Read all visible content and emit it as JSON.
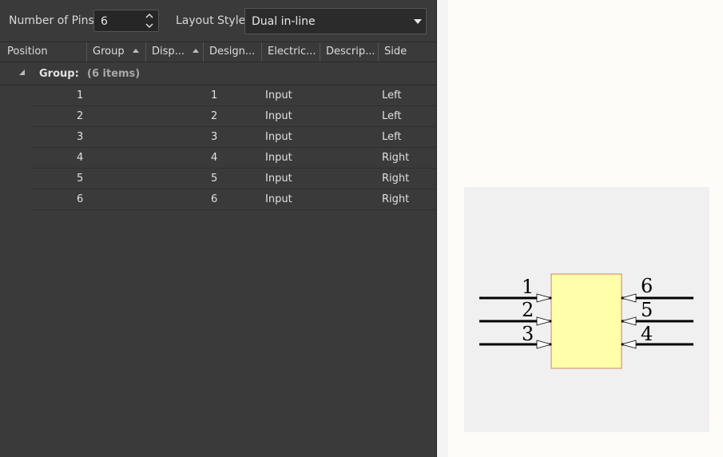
{
  "toolbar": {
    "pins_label": "Number of Pins",
    "pins_value": "6",
    "layout_label": "Layout Style",
    "layout_value": "Dual in-line"
  },
  "table": {
    "columns": [
      "Position",
      "Group",
      "Disp...",
      "Design...",
      "Electric...",
      "Descrip...",
      "Side"
    ],
    "group_label": "Group:",
    "group_count": "(6 items)",
    "rows": [
      {
        "position": "1",
        "designator": "1",
        "electrical": "Input",
        "side": "Left"
      },
      {
        "position": "2",
        "designator": "2",
        "electrical": "Input",
        "side": "Left"
      },
      {
        "position": "3",
        "designator": "3",
        "electrical": "Input",
        "side": "Left"
      },
      {
        "position": "4",
        "designator": "4",
        "electrical": "Input",
        "side": "Right"
      },
      {
        "position": "5",
        "designator": "5",
        "electrical": "Input",
        "side": "Right"
      },
      {
        "position": "6",
        "designator": "6",
        "electrical": "Input",
        "side": "Right"
      }
    ]
  },
  "preview": {
    "left_pins": [
      "1",
      "2",
      "3"
    ],
    "right_pins": [
      "6",
      "5",
      "4"
    ],
    "body_color": "#ffffaa",
    "body_border": "#d08060"
  }
}
